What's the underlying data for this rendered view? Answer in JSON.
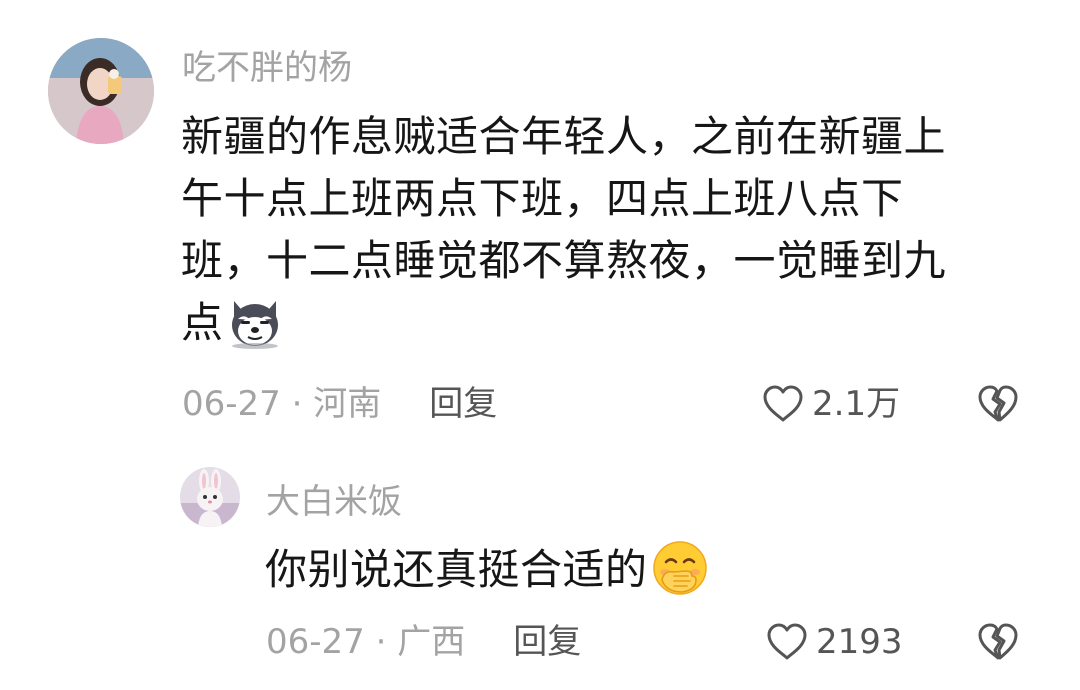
{
  "comments": [
    {
      "username": "吃不胖的杨",
      "content_lines": [
        "新疆的作息贼适合年轻人，之前在新疆上",
        "午十点上班两点下班，四点上班八点下",
        "班，十二点睡觉都不算熬夜，一觉睡到九",
        "点"
      ],
      "emoji": "husky-smirk-emoji",
      "meta": "06-27 · 河南",
      "reply_label": "回复",
      "likes": "2.1万"
    },
    {
      "username": "大白米饭",
      "content_lines": [
        "你别说还真挺合适的"
      ],
      "emoji": "hand-over-mouth-emoji",
      "meta": "06-27 · 广西",
      "reply_label": "回复",
      "likes": "2193"
    }
  ],
  "colors": {
    "secondary_text": "#a3a3a3",
    "body_text": "#161616",
    "action_text": "#555555"
  }
}
